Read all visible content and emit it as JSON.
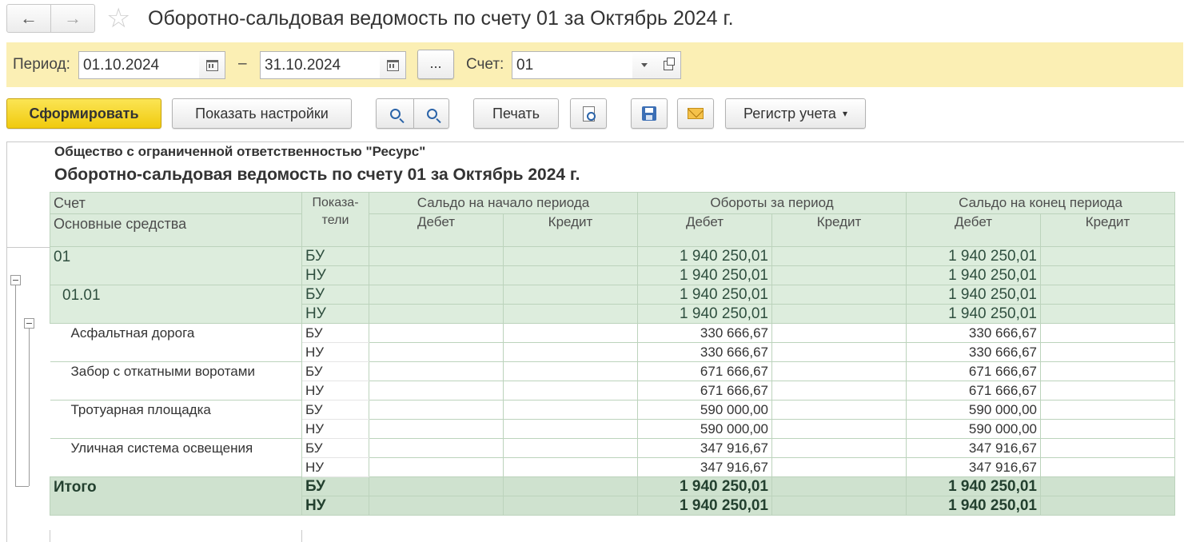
{
  "window": {
    "title": "Оборотно-сальдовая ведомость по счету 01 за Октябрь 2024 г.",
    "back_icon": "←",
    "forward_icon": "→",
    "favorite_icon": "☆"
  },
  "period": {
    "label": "Период:",
    "from": "01.10.2024",
    "dash": "–",
    "to": "31.10.2024",
    "more_label": "...",
    "account_label": "Счет:",
    "account_value": "01"
  },
  "toolbar": {
    "generate": "Сформировать",
    "show_settings": "Показать настройки",
    "print": "Печать",
    "register": "Регистр учета",
    "register_caret": "▾"
  },
  "report": {
    "org": "Общество с ограниченной ответственностью \"Ресурс\"",
    "title": "Оборотно-сальдовая ведомость по счету 01 за Октябрь 2024 г.",
    "header": {
      "account": "Счет",
      "account_sub": "Основные средства",
      "indicators": "Показа-\nтели",
      "opening": "Сальдо на начало периода",
      "turnover": "Обороты за период",
      "closing": "Сальдо на конец периода",
      "debit": "Дебет",
      "credit": "Кредит"
    },
    "groups": [
      {
        "name": "01",
        "rows": [
          {
            "ind": "БУ",
            "turn_debit": "1 940 250,01",
            "close_debit": "1 940 250,01"
          },
          {
            "ind": "НУ",
            "turn_debit": "1 940 250,01",
            "close_debit": "1 940 250,01"
          }
        ]
      },
      {
        "name": "01.01",
        "rows": [
          {
            "ind": "БУ",
            "turn_debit": "1 940 250,01",
            "close_debit": "1 940 250,01"
          },
          {
            "ind": "НУ",
            "turn_debit": "1 940 250,01",
            "close_debit": "1 940 250,01"
          }
        ]
      }
    ],
    "items": [
      {
        "name": "Асфальтная дорога",
        "rows": [
          {
            "ind": "БУ",
            "turn_debit": "330 666,67",
            "close_debit": "330 666,67"
          },
          {
            "ind": "НУ",
            "turn_debit": "330 666,67",
            "close_debit": "330 666,67"
          }
        ]
      },
      {
        "name": "Забор с откатными воротами",
        "rows": [
          {
            "ind": "БУ",
            "turn_debit": "671 666,67",
            "close_debit": "671 666,67"
          },
          {
            "ind": "НУ",
            "turn_debit": "671 666,67",
            "close_debit": "671 666,67"
          }
        ]
      },
      {
        "name": "Тротуарная площадка",
        "rows": [
          {
            "ind": "БУ",
            "turn_debit": "590 000,00",
            "close_debit": "590 000,00"
          },
          {
            "ind": "НУ",
            "turn_debit": "590 000,00",
            "close_debit": "590 000,00"
          }
        ]
      },
      {
        "name": "Уличная система освещения",
        "rows": [
          {
            "ind": "БУ",
            "turn_debit": "347 916,67",
            "close_debit": "347 916,67"
          },
          {
            "ind": "НУ",
            "turn_debit": "347 916,67",
            "close_debit": "347 916,67"
          }
        ]
      }
    ],
    "total": {
      "name": "Итого",
      "rows": [
        {
          "ind": "БУ",
          "turn_debit": "1 940 250,01",
          "close_debit": "1 940 250,01"
        },
        {
          "ind": "НУ",
          "turn_debit": "1 940 250,01",
          "close_debit": "1 940 250,01"
        }
      ]
    }
  }
}
